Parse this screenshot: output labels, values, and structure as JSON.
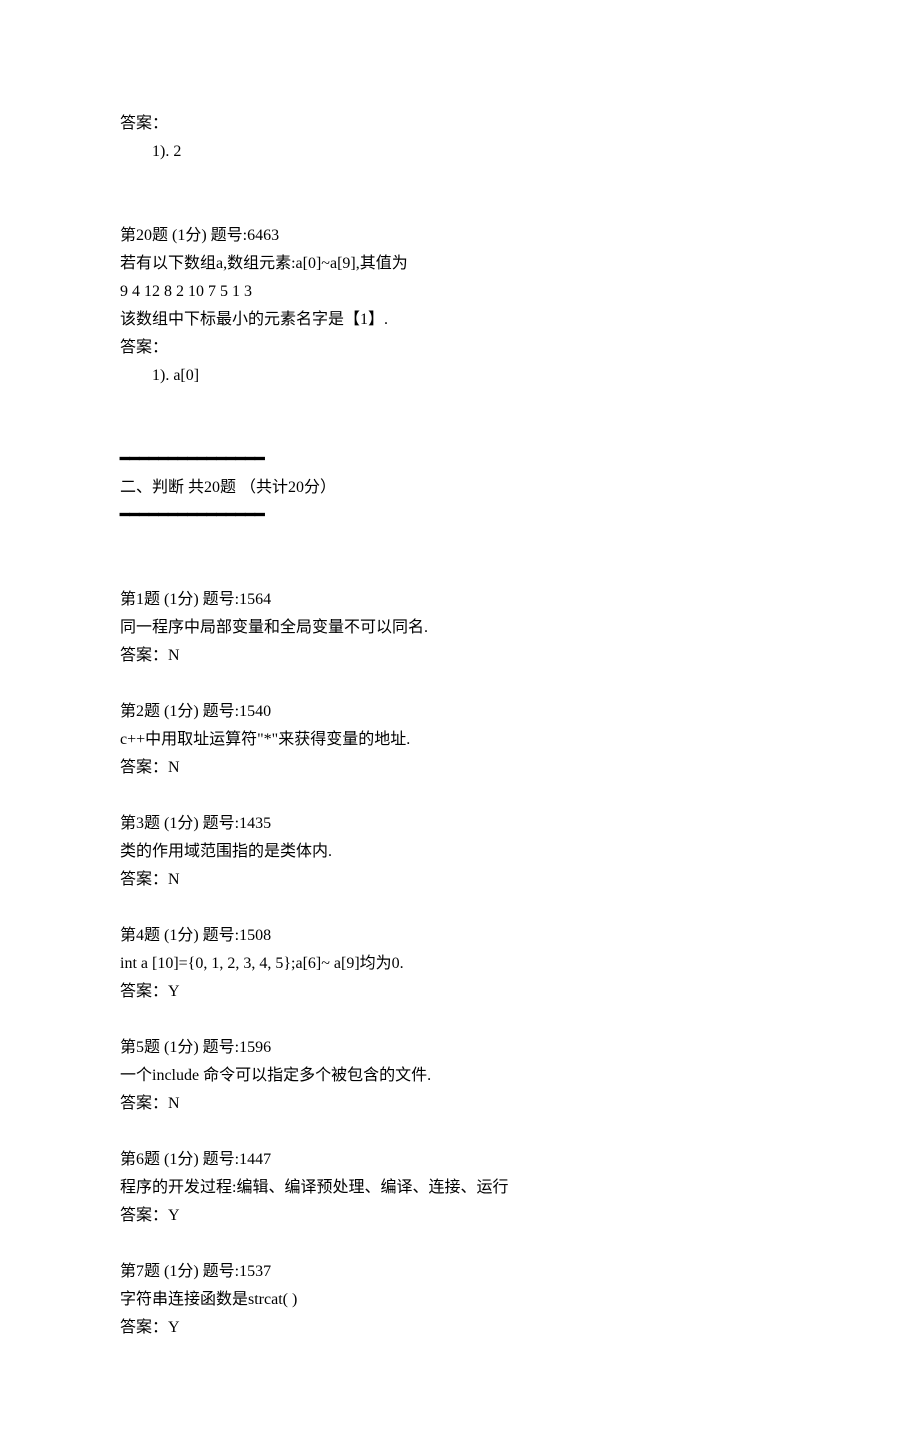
{
  "q19": {
    "ans_label": "答案：",
    "ans_value": "1). 2"
  },
  "q20": {
    "header": "第20题  (1分)   题号:6463",
    "line1": "若有以下数组a,数组元素:a[0]~a[9],其值为",
    "line2": " 9  4  12  8  2  10  7  5  1  3",
    "line3": "该数组中下标最小的元素名字是【1】.",
    "ans_label": "答案：",
    "ans_value": "1). a[0]"
  },
  "section2": {
    "divider": "━━━━━━━━━━━━━━━",
    "title": "二、判断   共20题 （共计20分）"
  },
  "j1": {
    "header": "第1题  (1分)   题号:1564",
    "text": "同一程序中局部变量和全局变量不可以同名.",
    "ans": "答案：N"
  },
  "j2": {
    "header": "第2题  (1分)   题号:1540",
    "text": "c++中用取址运算符\"*\"来获得变量的地址.",
    "ans": "答案：N"
  },
  "j3": {
    "header": "第3题  (1分)   题号:1435",
    "text": "类的作用域范围指的是类体内.",
    "ans": "答案：N"
  },
  "j4": {
    "header": "第4题  (1分)   题号:1508",
    "text": "int a [10]={0, 1, 2, 3, 4, 5};a[6]~ a[9]均为0.",
    "ans": "答案：Y"
  },
  "j5": {
    "header": "第5题  (1分)   题号:1596",
    "text": "一个include 命令可以指定多个被包含的文件.",
    "ans": "答案：N"
  },
  "j6": {
    "header": "第6题  (1分)   题号:1447",
    "text": "程序的开发过程:编辑、编译预处理、编译、连接、运行",
    "ans": "答案：Y"
  },
  "j7": {
    "header": "第7题  (1分)   题号:1537",
    "text": "字符串连接函数是strcat( )",
    "ans": "答案：Y"
  }
}
